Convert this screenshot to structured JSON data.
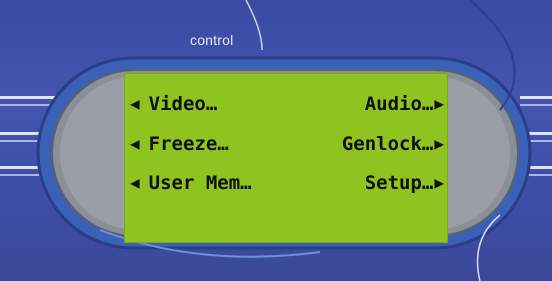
{
  "panel": {
    "label": "control",
    "colors": {
      "background": "#4455b0",
      "lcd": "#8fc31f",
      "lcd_text": "#101010"
    }
  },
  "menu": {
    "rows": [
      {
        "left": {
          "label": "Video…",
          "icon": "left-arrow-icon",
          "glyph": "◀"
        },
        "right": {
          "label": "Audio…",
          "icon": "right-arrow-icon",
          "glyph": "▶"
        }
      },
      {
        "left": {
          "label": "Freeze…",
          "icon": "left-arrow-icon",
          "glyph": "◀"
        },
        "right": {
          "label": "Genlock…",
          "icon": "right-arrow-icon",
          "glyph": "▶"
        }
      },
      {
        "left": {
          "label": "User Mem…",
          "icon": "left-arrow-icon",
          "glyph": "◀"
        },
        "right": {
          "label": "Setup…",
          "icon": "right-arrow-icon",
          "glyph": "▶"
        }
      }
    ]
  }
}
